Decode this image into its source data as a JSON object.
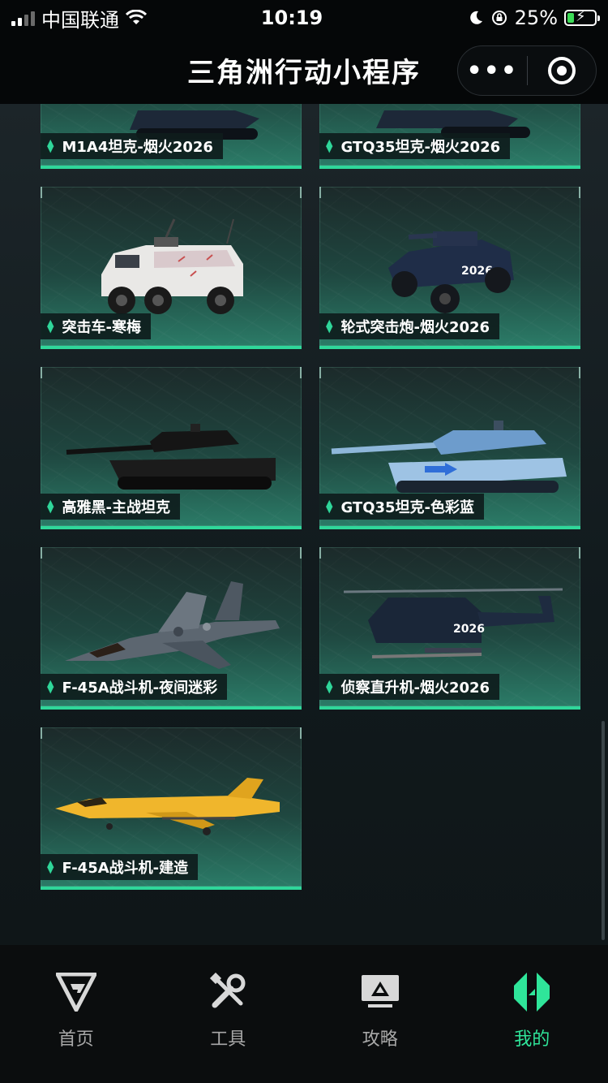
{
  "status_bar": {
    "carrier": "中国联通",
    "time": "10:19",
    "battery": "25%"
  },
  "nav": {
    "title": "三角洲行动小程序",
    "more_icon": "more-dots-icon",
    "close_icon": "target-close-icon"
  },
  "cards": [
    {
      "label": "M1A4坦克-烟火2026",
      "icon": "tank-icon"
    },
    {
      "label": "GTQ35坦克-烟火2026",
      "icon": "tank-icon"
    },
    {
      "label": "突击车-寒梅",
      "icon": "armored-car-icon"
    },
    {
      "label": "轮式突击炮-烟火2026",
      "icon": "armored-car-icon"
    },
    {
      "label": "高雅黑-主战坦克",
      "icon": "tank-icon"
    },
    {
      "label": "GTQ35坦克-色彩蓝",
      "icon": "tank-icon"
    },
    {
      "label": "F-45A战斗机-夜间迷彩",
      "icon": "fighter-jet-icon"
    },
    {
      "label": "侦察直升机-烟火2026",
      "icon": "helicopter-icon"
    },
    {
      "label": "F-45A战斗机-建造",
      "icon": "fighter-jet-icon"
    }
  ],
  "tabs": [
    {
      "label": "首页",
      "icon": "home-triangle-icon",
      "active": false
    },
    {
      "label": "工具",
      "icon": "tools-icon",
      "active": false
    },
    {
      "label": "攻略",
      "icon": "guide-monitor-icon",
      "active": false
    },
    {
      "label": "我的",
      "icon": "profile-logo-icon",
      "active": true
    }
  ],
  "colors": {
    "accent": "#2fd79a",
    "active_tab": "#2fe59a",
    "background": "#0d1316"
  }
}
